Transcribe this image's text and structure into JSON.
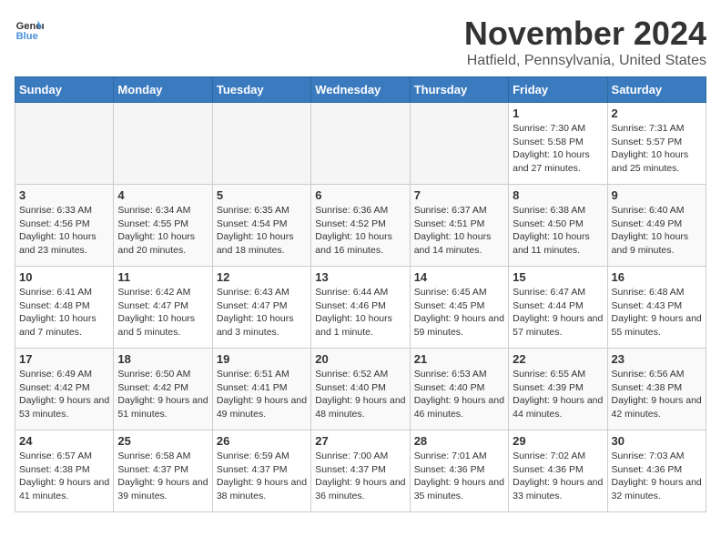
{
  "logo": {
    "text_general": "General",
    "text_blue": "Blue"
  },
  "header": {
    "month_title": "November 2024",
    "location": "Hatfield, Pennsylvania, United States"
  },
  "weekdays": [
    "Sunday",
    "Monday",
    "Tuesday",
    "Wednesday",
    "Thursday",
    "Friday",
    "Saturday"
  ],
  "weeks": [
    [
      {
        "day": "",
        "empty": true
      },
      {
        "day": "",
        "empty": true
      },
      {
        "day": "",
        "empty": true
      },
      {
        "day": "",
        "empty": true
      },
      {
        "day": "",
        "empty": true
      },
      {
        "day": "1",
        "sunrise": "7:30 AM",
        "sunset": "5:58 PM",
        "daylight": "10 hours and 27 minutes."
      },
      {
        "day": "2",
        "sunrise": "7:31 AM",
        "sunset": "5:57 PM",
        "daylight": "10 hours and 25 minutes."
      }
    ],
    [
      {
        "day": "3",
        "sunrise": "6:33 AM",
        "sunset": "4:56 PM",
        "daylight": "10 hours and 23 minutes."
      },
      {
        "day": "4",
        "sunrise": "6:34 AM",
        "sunset": "4:55 PM",
        "daylight": "10 hours and 20 minutes."
      },
      {
        "day": "5",
        "sunrise": "6:35 AM",
        "sunset": "4:54 PM",
        "daylight": "10 hours and 18 minutes."
      },
      {
        "day": "6",
        "sunrise": "6:36 AM",
        "sunset": "4:52 PM",
        "daylight": "10 hours and 16 minutes."
      },
      {
        "day": "7",
        "sunrise": "6:37 AM",
        "sunset": "4:51 PM",
        "daylight": "10 hours and 14 minutes."
      },
      {
        "day": "8",
        "sunrise": "6:38 AM",
        "sunset": "4:50 PM",
        "daylight": "10 hours and 11 minutes."
      },
      {
        "day": "9",
        "sunrise": "6:40 AM",
        "sunset": "4:49 PM",
        "daylight": "10 hours and 9 minutes."
      }
    ],
    [
      {
        "day": "10",
        "sunrise": "6:41 AM",
        "sunset": "4:48 PM",
        "daylight": "10 hours and 7 minutes."
      },
      {
        "day": "11",
        "sunrise": "6:42 AM",
        "sunset": "4:47 PM",
        "daylight": "10 hours and 5 minutes."
      },
      {
        "day": "12",
        "sunrise": "6:43 AM",
        "sunset": "4:47 PM",
        "daylight": "10 hours and 3 minutes."
      },
      {
        "day": "13",
        "sunrise": "6:44 AM",
        "sunset": "4:46 PM",
        "daylight": "10 hours and 1 minute."
      },
      {
        "day": "14",
        "sunrise": "6:45 AM",
        "sunset": "4:45 PM",
        "daylight": "9 hours and 59 minutes."
      },
      {
        "day": "15",
        "sunrise": "6:47 AM",
        "sunset": "4:44 PM",
        "daylight": "9 hours and 57 minutes."
      },
      {
        "day": "16",
        "sunrise": "6:48 AM",
        "sunset": "4:43 PM",
        "daylight": "9 hours and 55 minutes."
      }
    ],
    [
      {
        "day": "17",
        "sunrise": "6:49 AM",
        "sunset": "4:42 PM",
        "daylight": "9 hours and 53 minutes."
      },
      {
        "day": "18",
        "sunrise": "6:50 AM",
        "sunset": "4:42 PM",
        "daylight": "9 hours and 51 minutes."
      },
      {
        "day": "19",
        "sunrise": "6:51 AM",
        "sunset": "4:41 PM",
        "daylight": "9 hours and 49 minutes."
      },
      {
        "day": "20",
        "sunrise": "6:52 AM",
        "sunset": "4:40 PM",
        "daylight": "9 hours and 48 minutes."
      },
      {
        "day": "21",
        "sunrise": "6:53 AM",
        "sunset": "4:40 PM",
        "daylight": "9 hours and 46 minutes."
      },
      {
        "day": "22",
        "sunrise": "6:55 AM",
        "sunset": "4:39 PM",
        "daylight": "9 hours and 44 minutes."
      },
      {
        "day": "23",
        "sunrise": "6:56 AM",
        "sunset": "4:38 PM",
        "daylight": "9 hours and 42 minutes."
      }
    ],
    [
      {
        "day": "24",
        "sunrise": "6:57 AM",
        "sunset": "4:38 PM",
        "daylight": "9 hours and 41 minutes."
      },
      {
        "day": "25",
        "sunrise": "6:58 AM",
        "sunset": "4:37 PM",
        "daylight": "9 hours and 39 minutes."
      },
      {
        "day": "26",
        "sunrise": "6:59 AM",
        "sunset": "4:37 PM",
        "daylight": "9 hours and 38 minutes."
      },
      {
        "day": "27",
        "sunrise": "7:00 AM",
        "sunset": "4:37 PM",
        "daylight": "9 hours and 36 minutes."
      },
      {
        "day": "28",
        "sunrise": "7:01 AM",
        "sunset": "4:36 PM",
        "daylight": "9 hours and 35 minutes."
      },
      {
        "day": "29",
        "sunrise": "7:02 AM",
        "sunset": "4:36 PM",
        "daylight": "9 hours and 33 minutes."
      },
      {
        "day": "30",
        "sunrise": "7:03 AM",
        "sunset": "4:36 PM",
        "daylight": "9 hours and 32 minutes."
      }
    ]
  ]
}
